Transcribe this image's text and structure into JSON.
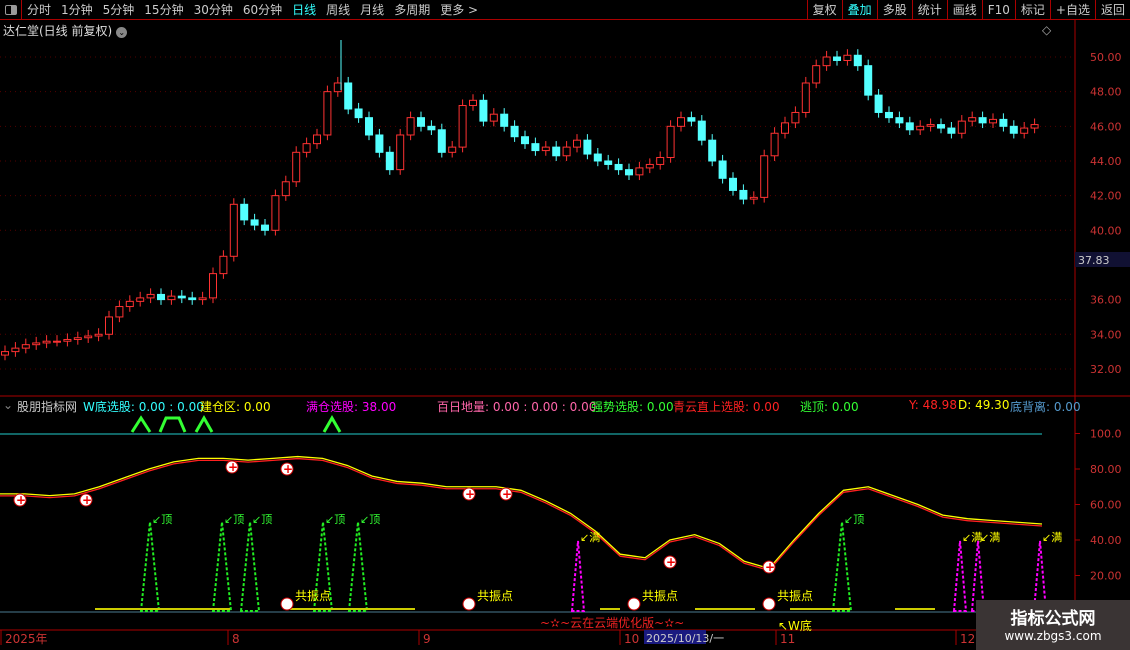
{
  "toolbar": {
    "periods": [
      "分时",
      "1分钟",
      "5分钟",
      "15分钟",
      "30分钟",
      "60分钟",
      "日线",
      "周线",
      "月线",
      "多周期",
      "更多 >"
    ],
    "active_period": "日线",
    "right_buttons": [
      "复权",
      "叠加",
      "多股",
      "统计",
      "画线",
      "F10",
      "标记",
      "+自选",
      "返回"
    ],
    "active_right": "叠加"
  },
  "stock_title": "达仁堂(日线 前复权)",
  "price_axis": {
    "labels": [
      "50.00",
      "48.00",
      "46.00",
      "44.00",
      "42.00",
      "40.00",
      "36.00",
      "34.00",
      "32.00"
    ],
    "current": "37.83"
  },
  "indicator_axis": [
    "100.0",
    "80.00",
    "60.00",
    "40.00",
    "20.00"
  ],
  "indicator_header": {
    "name": "股朋指标网",
    "w_bottom": "W底选股: 0.00 : 0.00",
    "build": "建仓区: 0.00",
    "full": "满仓选股: 38.00",
    "hundred": "百日地量: 0.00 : 0.00 : 0.00",
    "strong": "强势选股: 0.00",
    "cloud": "青云直上选股: 0.00",
    "escape": "逃顶: 0.00",
    "y": "Y: 48.98",
    "d": "D: 49.30",
    "div": "底背离: 0.00"
  },
  "colors": {
    "up": "#ff3232",
    "down": "#54ffff",
    "axis": "#aa0000",
    "yline": "#ffff00",
    "dline": "#ff2020"
  },
  "chart_data": {
    "type": "candlestick",
    "ylim": [
      31,
      51
    ],
    "close": [
      33.0,
      33.2,
      33.4,
      33.5,
      33.6,
      33.6,
      33.7,
      33.8,
      33.9,
      34.0,
      35.0,
      35.6,
      35.9,
      36.1,
      36.3,
      36.0,
      36.2,
      36.1,
      36.0,
      36.1,
      37.5,
      38.5,
      41.5,
      40.6,
      40.3,
      40.0,
      42.0,
      42.8,
      44.5,
      45.0,
      45.5,
      48.0,
      48.5,
      47.0,
      46.5,
      45.5,
      44.5,
      43.5,
      45.5,
      46.5,
      46.0,
      45.8,
      44.5,
      44.8,
      47.2,
      47.5,
      46.3,
      46.7,
      46.0,
      45.4,
      45.0,
      44.6,
      44.8,
      44.3,
      44.8,
      45.2,
      44.4,
      44.0,
      43.8,
      43.5,
      43.2,
      43.6,
      43.8,
      44.2,
      46.0,
      46.5,
      46.3,
      45.2,
      44.0,
      43.0,
      42.3,
      41.8,
      41.9,
      44.3,
      45.6,
      46.2,
      46.8,
      48.5,
      49.5,
      50.0,
      49.8,
      50.1,
      49.5,
      47.8,
      46.8,
      46.5,
      46.2,
      45.8,
      46.0,
      46.1,
      45.9,
      45.6,
      46.3,
      46.5,
      46.2,
      46.4,
      46.0,
      45.6,
      45.9,
      46.1
    ],
    "indicator_line": [
      66,
      66,
      65,
      66,
      70,
      75,
      80,
      84,
      86,
      86,
      85,
      86,
      87,
      86,
      82,
      76,
      73,
      72,
      70,
      70,
      70,
      68,
      62,
      55,
      45,
      32,
      30,
      40,
      43,
      38,
      28,
      24,
      40,
      55,
      68,
      70,
      65,
      60,
      54,
      52,
      51,
      50,
      49
    ],
    "top_signals": [
      150,
      222,
      250,
      323,
      358,
      842
    ],
    "full_signals": [
      578,
      960,
      978,
      1040
    ],
    "resonance_label": "共振点",
    "top_label": "顶",
    "full_label": "满",
    "wbottom_label": "↖W底",
    "version_label": "~✫~云在云端优化版~✫~"
  },
  "time_axis": {
    "labels": [
      "2025年",
      "8",
      "9",
      "10",
      "11",
      "12"
    ],
    "cursor": "2025/10/13/一"
  },
  "watermark": {
    "title": "指标公式网",
    "url": "www.zbgs3.com"
  }
}
